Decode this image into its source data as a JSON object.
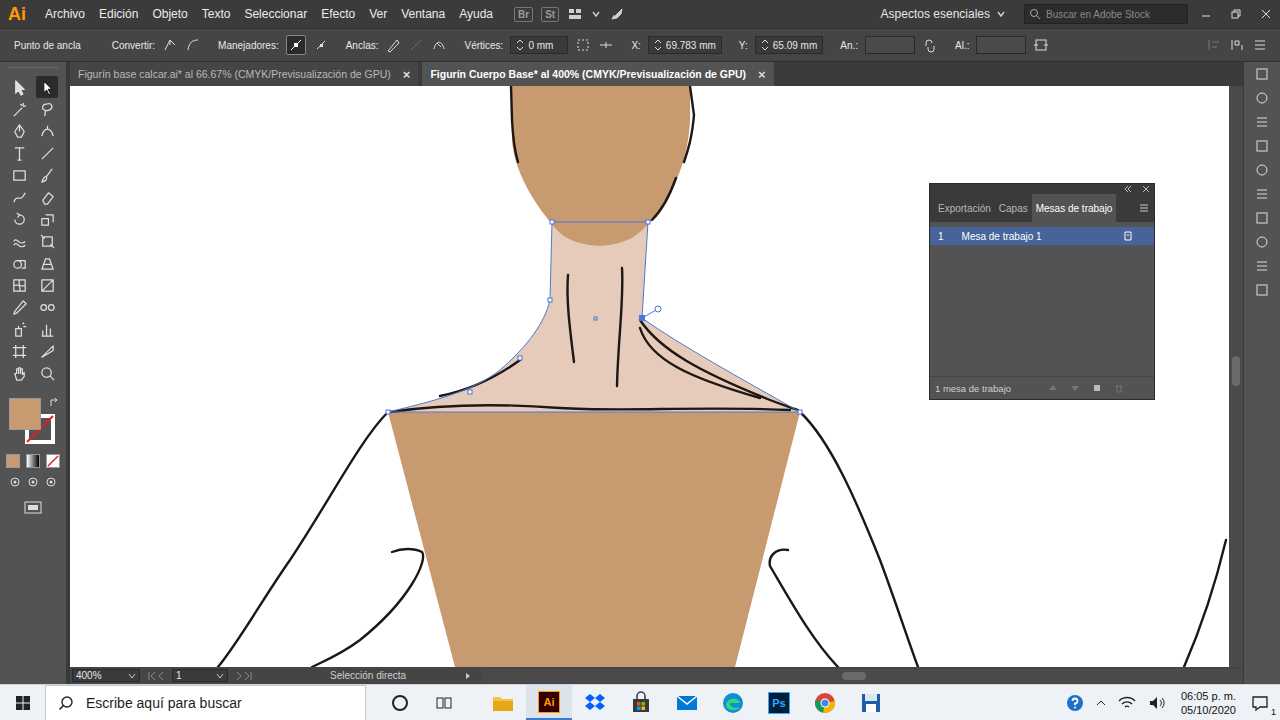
{
  "app": {
    "logo": "Ai"
  },
  "menu": [
    "Archivo",
    "Edición",
    "Objeto",
    "Texto",
    "Seleccionar",
    "Efecto",
    "Ver",
    "Ventana",
    "Ayuda"
  ],
  "bridge": [
    "Br",
    "St"
  ],
  "workspace": "Aspectos esenciales",
  "search": {
    "placeholder": "Buscar en Adobe Stock"
  },
  "control_bar": {
    "selection": "Punto de ancla",
    "convert": "Convertir:",
    "handles": "Manejadores:",
    "anchors": "Anclas:",
    "corners": "Vértices:",
    "corner_value": "0 mm",
    "x_label": "X:",
    "x_value": "69.783 mm",
    "y_label": "Y:",
    "y_value": "65.09 mm",
    "w_label": "An.:",
    "h_label": "Al.:"
  },
  "tabs": [
    {
      "label": "Figurín base calcar.ai* al 66.67% (CMYK/Previsualización de GPU)",
      "close": "×",
      "selected": false
    },
    {
      "label": "Figurín Cuerpo Base* al 400% (CMYK/Previsualización de GPU)",
      "close": "×",
      "selected": true
    }
  ],
  "tools": [
    {
      "kind": "selection",
      "selected": false
    },
    {
      "kind": "direct-selection",
      "selected": true
    },
    {
      "kind": "magic-wand",
      "selected": false
    },
    {
      "kind": "lasso",
      "selected": false
    },
    {
      "kind": "pen",
      "selected": false
    },
    {
      "kind": "curvature",
      "selected": false
    },
    {
      "kind": "type",
      "selected": false
    },
    {
      "kind": "line",
      "selected": false
    },
    {
      "kind": "rectangle",
      "selected": false
    },
    {
      "kind": "paintbrush",
      "selected": false
    },
    {
      "kind": "shaper",
      "selected": false
    },
    {
      "kind": "eraser",
      "selected": false
    },
    {
      "kind": "rotate",
      "selected": false
    },
    {
      "kind": "scale",
      "selected": false
    },
    {
      "kind": "warp",
      "selected": false
    },
    {
      "kind": "free-transform",
      "selected": false
    },
    {
      "kind": "shape-builder",
      "selected": false
    },
    {
      "kind": "perspective",
      "selected": false
    },
    {
      "kind": "mesh",
      "selected": false
    },
    {
      "kind": "gradient",
      "selected": false
    },
    {
      "kind": "eyedropper",
      "selected": false
    },
    {
      "kind": "blend",
      "selected": false
    },
    {
      "kind": "symbol-sprayer",
      "selected": false
    },
    {
      "kind": "column-graph",
      "selected": false
    },
    {
      "kind": "artboard",
      "selected": false
    },
    {
      "kind": "slice",
      "selected": false
    },
    {
      "kind": "hand",
      "selected": false
    },
    {
      "kind": "zoom",
      "selected": false
    }
  ],
  "panel": {
    "tabs": [
      {
        "label": "Exportación",
        "selected": false
      },
      {
        "label": "Capas",
        "selected": false
      },
      {
        "label": "Mesas de trabajo",
        "selected": true
      }
    ],
    "rows": [
      {
        "number": "1",
        "name": "Mesa de trabajo 1",
        "selected": true
      }
    ],
    "footer": "1 mesa de trabajo"
  },
  "status_bar": {
    "zoom": "400%",
    "artboard": "1",
    "tool": "Selección directa"
  },
  "taskbar": {
    "search_placeholder": "Escribe aquí para buscar",
    "apps": [
      {
        "kind": "explorer",
        "label": "",
        "active": false
      },
      {
        "kind": "illustrator",
        "label": "Ai",
        "active": true
      },
      {
        "kind": "dropbox",
        "label": "",
        "active": false
      },
      {
        "kind": "store",
        "label": "",
        "active": false
      },
      {
        "kind": "mail",
        "label": "",
        "active": false
      },
      {
        "kind": "edge",
        "label": "",
        "active": false
      },
      {
        "kind": "photoshop",
        "label": "Ps",
        "active": false
      },
      {
        "kind": "chrome",
        "label": "",
        "active": false
      },
      {
        "kind": "disk",
        "label": "",
        "active": false
      }
    ],
    "time": "06:05 p. m.",
    "date": "05/10/2020",
    "notifications": "1"
  }
}
